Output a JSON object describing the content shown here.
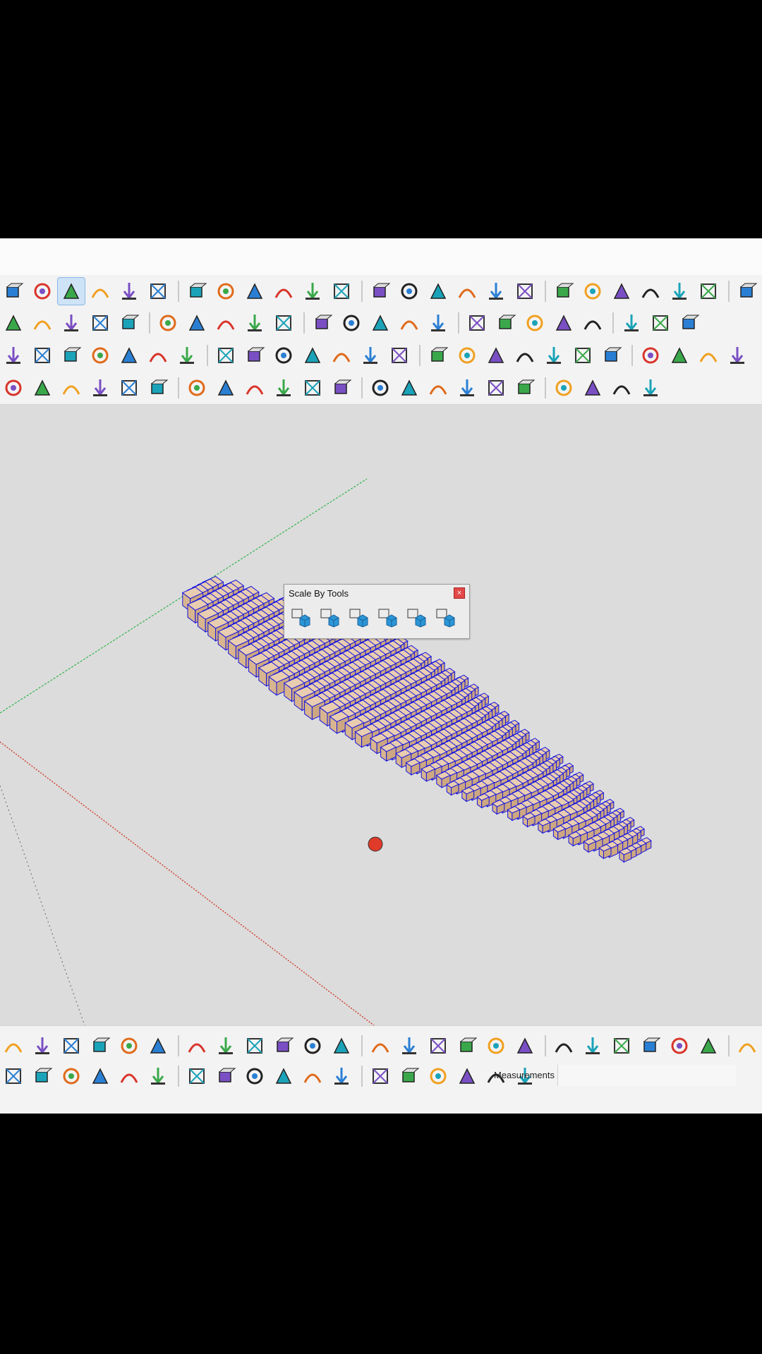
{
  "panel": {
    "title": "Scale By Tools",
    "close_label": "×"
  },
  "status": {
    "measurements_label": "Measurements"
  },
  "colors": {
    "axis_green": "#2fb34a",
    "axis_red": "#d23a2a",
    "cube_edge": "#1414e0",
    "cube_face": "#e7c7a2"
  },
  "toolbar": {
    "row1": [
      "component-icon",
      "paint-bucket-icon",
      "orbit-icon",
      "pan-icon",
      "zoom-icon",
      "zoom-extents-icon",
      "section-icon",
      "layers-icon",
      "layer-stack-icon",
      "tag-icon",
      "user-icon",
      "dropdown-arrow-icon",
      "layers-stack-2-icon",
      "layers-stack-3-icon",
      "material-red-icon",
      "material-blue-icon",
      "shield-icon",
      "tape-icon",
      "geo-icon",
      "push-up-icon",
      "push-down-icon",
      "push-blue-icon",
      "push-red-icon",
      "push-green-icon",
      "push-red2-icon"
    ],
    "row2": [
      "axes-icon",
      "arrow-red-icon",
      "arrow-green-icon",
      "arrow-blue-icon",
      "tools-icon",
      "palette-icon",
      "globe-icon",
      "sliders-icon",
      "help-icon",
      "eye-icon",
      "close-circle-icon",
      "gradient-icon",
      "cursor-icon",
      "knife-icon",
      "column-icon",
      "hose-icon",
      "brush-icon",
      "tree-icon",
      "box-orange-icon",
      "shapes-icon",
      "paint-icon",
      "trim-icon",
      "bend-icon"
    ],
    "row3": [
      "extrude-icon",
      "box-outline-icon",
      "box-icon",
      "grass-icon",
      "follow-icon",
      "grid-box-icon",
      "slice-icon",
      "table-icon",
      "bubble-icon",
      "figure-icon",
      "house-icon",
      "trough-icon",
      "ring-icon",
      "ruler-tri-icon",
      "tee-icon",
      "sun-icon",
      "dome-icon",
      "ball-icon",
      "clone-icon",
      "copy-icon",
      "checker-icon",
      "cube-3d-icon",
      "cube-grid-icon",
      "sphere-icon",
      "sphere2-icon"
    ],
    "row4": [
      "line-icon",
      "arc-green-icon",
      "rect-icon",
      "spiral-icon",
      "arc-icon",
      "zigzag-icon",
      "curve-icon",
      "arc2-icon",
      "arc-red-icon",
      "polyline-icon",
      "gear-icon",
      "wrench-icon",
      "oval-icon",
      "triangle-icon",
      "wand-icon",
      "wand2-icon",
      "spring-icon",
      "cube-blue-icon",
      "fx-icon",
      "graph-icon",
      "pen-icon",
      "round-icon"
    ]
  },
  "scale_tools": [
    "scale-box-1-icon",
    "scale-box-2-icon",
    "scale-box-3-icon",
    "scale-box-4-icon",
    "scale-user-icon",
    "scale-user-2-icon"
  ],
  "bottom": {
    "row1": [
      "ruler-icon",
      "move-icon",
      "scatter-icon",
      "xyz-icon",
      "drop-icon",
      "mushroom-icon",
      "filter-icon",
      "lasso-icon",
      "fence-icon",
      "select-box-icon",
      "brush-select-icon",
      "path-select-icon",
      "back-icon",
      "forward-icon",
      "grid-eye-icon",
      "bucket-red-icon",
      "bucket-minus-icon",
      "bucket-minus-2-icon",
      "wall-icon",
      "wall-2-icon",
      "pipe-icon",
      "sphere-dark-icon",
      "cone-icon",
      "torus-icon",
      "corner-icon"
    ],
    "row2": [
      "arrow-left-icon",
      "move-cross-icon",
      "rotate-icon",
      "resize-icon",
      "tape-measure-icon",
      "cube-frame-icon",
      "sphere-green-icon",
      "sphere-green-2-icon",
      "sphere-green-3-icon",
      "sphere-outline-icon",
      "sphere-pink-icon",
      "sphere-lines-icon",
      "sphere-red-icon",
      "sphere-red-half-icon",
      "santa-icon",
      "cursor-blue-icon",
      "shield-half-icon",
      "pie-icon"
    ]
  }
}
